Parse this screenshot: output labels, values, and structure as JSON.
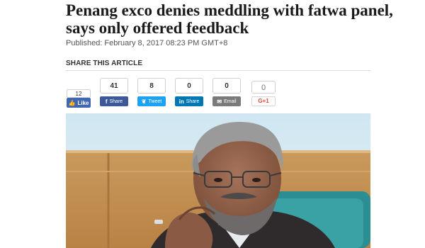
{
  "article": {
    "headline": "Penang exco denies meddling with fatwa panel, says only offered feedback",
    "published": "Published: February 8, 2017 08:23 PM GMT+8"
  },
  "share": {
    "title": "SHARE THIS ARTICLE",
    "like": {
      "count": "12",
      "label": "Like",
      "color": "#4267b2"
    },
    "facebook": {
      "count": "41",
      "label": "Share",
      "color": "#3b5998"
    },
    "twitter": {
      "count": "8",
      "label": "Tweet",
      "color": "#1da1f2"
    },
    "linkedin": {
      "count": "0",
      "label": "Share",
      "color": "#0077b5"
    },
    "email": {
      "count": "0",
      "label": "Email",
      "color": "#7a7a7a"
    },
    "googleplus": {
      "count": "0",
      "label": "G+1",
      "color": "#dd4b39"
    }
  },
  "photo": {
    "description_icon": "portrait-photo"
  }
}
